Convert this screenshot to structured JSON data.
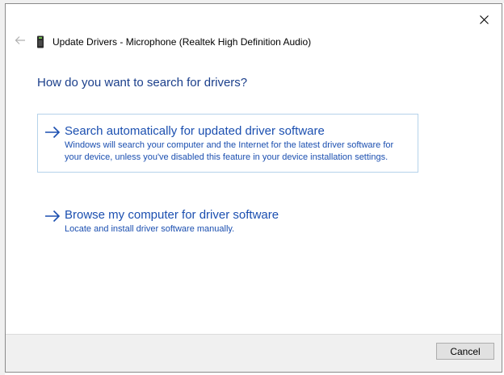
{
  "window": {
    "title": "Update Drivers - Microphone (Realtek High Definition Audio)",
    "close_glyph": "✕"
  },
  "main": {
    "heading": "How do you want to search for drivers?",
    "options": [
      {
        "title": "Search automatically for updated driver software",
        "description": "Windows will search your computer and the Internet for the latest driver software for your device, unless you've disabled this feature in your device installation settings.",
        "icon": "arrow-right-icon"
      },
      {
        "title": "Browse my computer for driver software",
        "description": "Locate and install driver software manually.",
        "icon": "arrow-right-icon"
      }
    ]
  },
  "footer": {
    "cancel_label": "Cancel"
  },
  "colors": {
    "heading": "#1b3f8b",
    "link": "#1b4fb0",
    "selected_border": "#b5d2ea",
    "footer_bg": "#f0f0f0"
  }
}
